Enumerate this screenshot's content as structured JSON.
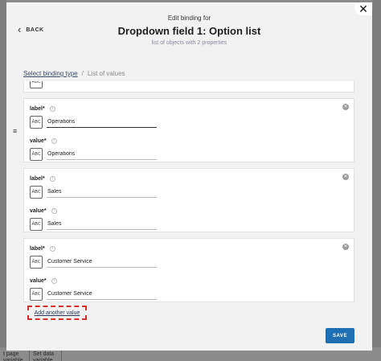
{
  "backdrop": {
    "bottom_left_1": "t page variable",
    "bottom_left_2": "Set data variable"
  },
  "modal": {
    "back_label": "BACK",
    "kicker": "Edit binding for",
    "title": "Dropdown field 1: Option list",
    "subtitle": "list of objects with 2 properties",
    "close_label": "✕"
  },
  "breadcrumb": {
    "link": "Select binding type",
    "separator": "/",
    "current": "List of values"
  },
  "items": [
    {
      "label_title": "label*",
      "label_value": "Operations",
      "value_title": "value*",
      "value_value": "Operations"
    },
    {
      "label_title": "label*",
      "label_value": "Sales",
      "value_title": "value*",
      "value_value": "Sales"
    },
    {
      "label_title": "label*",
      "label_value": "Customer Service",
      "value_title": "value*",
      "value_value": "Customer Service"
    }
  ],
  "type_icon": "ABC",
  "add_value_label": "Add another value",
  "save_label": "SAVE",
  "colors": {
    "accent": "#1f6fb3",
    "highlight": "#d32f2f"
  }
}
